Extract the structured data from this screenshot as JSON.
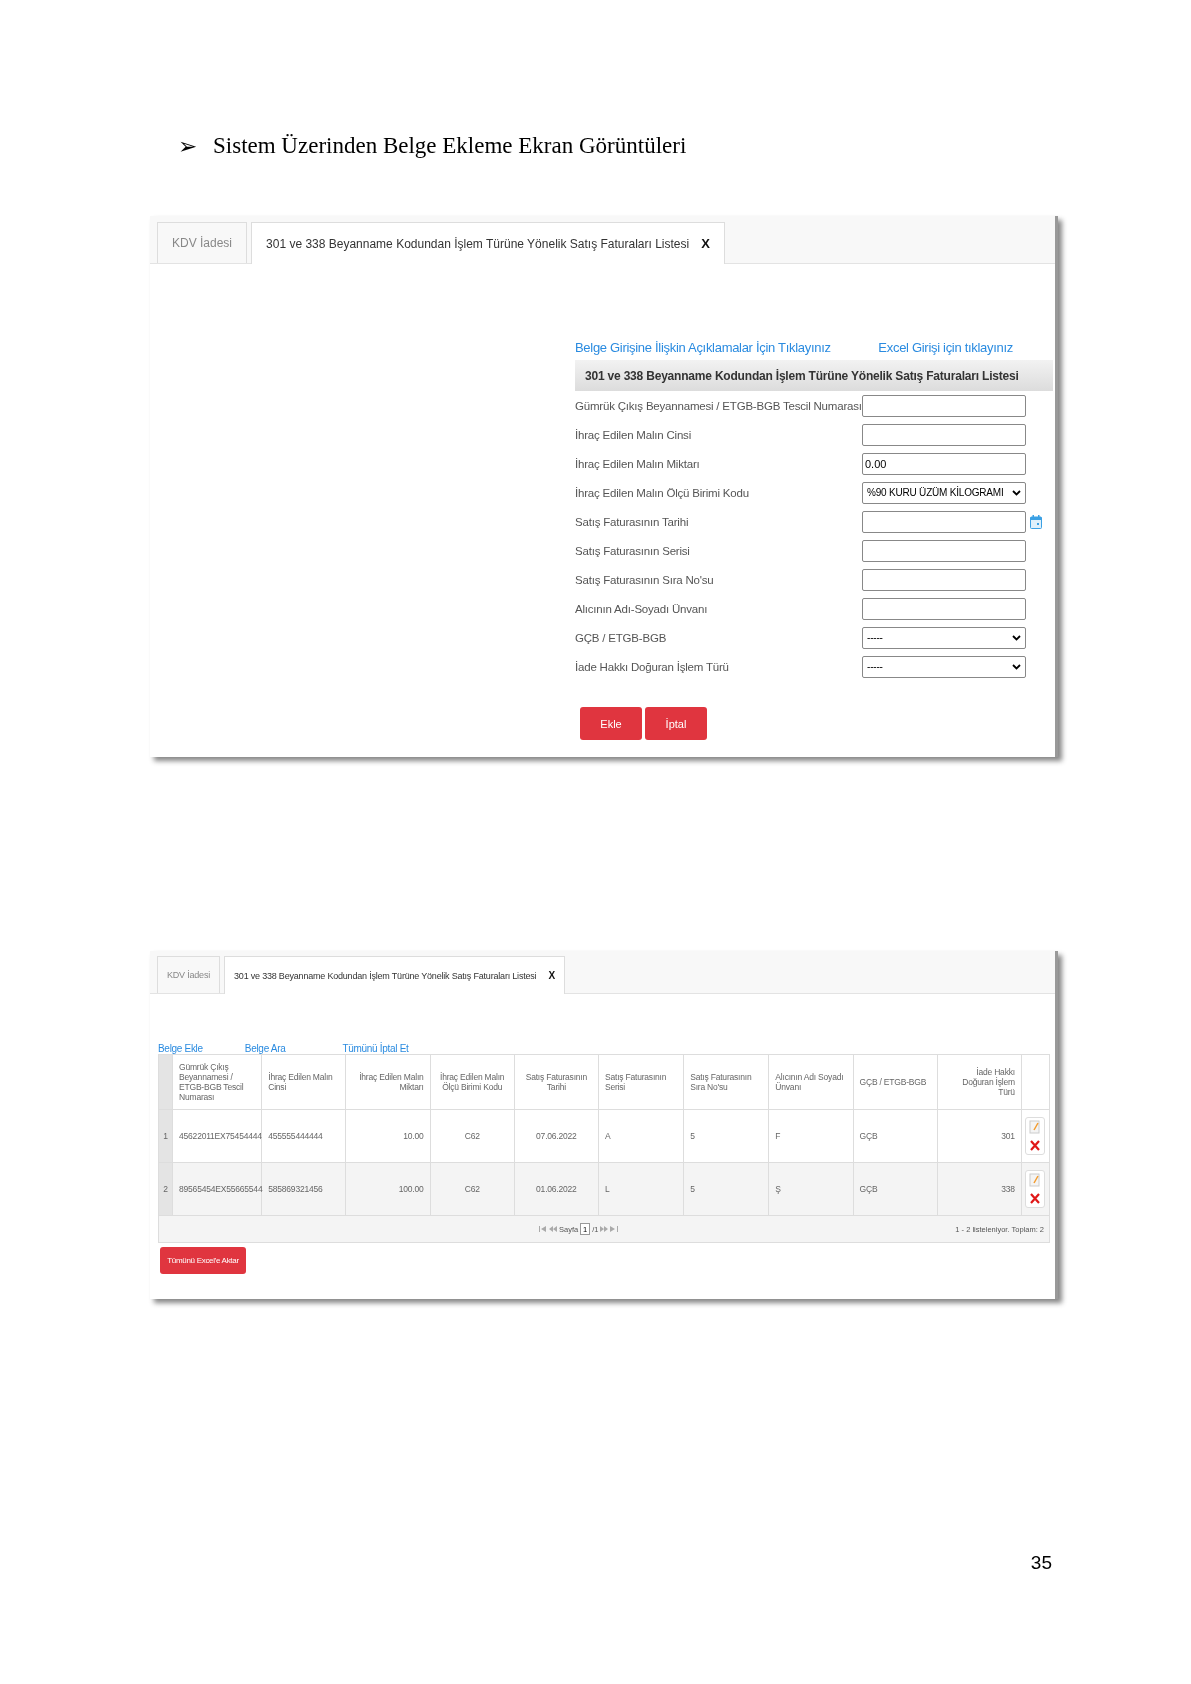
{
  "heading": {
    "bullet": "➢",
    "text": "Sistem Üzerinden Belge Ekleme Ekran Görüntüleri"
  },
  "form_screen": {
    "tabs": [
      {
        "label": "KDV İadesi",
        "selected": false
      },
      {
        "label": "301 ve 338 Beyanname Kodundan İşlem Türüne Yönelik Satış Faturaları Listesi",
        "selected": true,
        "close": "X"
      }
    ],
    "links": [
      "Belge Girişine İlişkin Açıklamalar İçin Tıklayınız",
      "Excel Girişi için tıklayınız"
    ],
    "panel_title": "301 ve 338 Beyanname Kodundan İşlem Türüne Yönelik Satış Faturaları Listesi",
    "fields": [
      {
        "label": "Gümrük Çıkış Beyannamesi / ETGB-BGB Tescil Numarası",
        "kind": "text"
      },
      {
        "label": "İhraç Edilen Malın Cinsi",
        "kind": "text"
      },
      {
        "label": "İhraç Edilen Malın Miktarı",
        "kind": "text",
        "value": "0.00"
      },
      {
        "label": "İhraç Edilen Malın Ölçü Birimi Kodu",
        "kind": "select",
        "value": "%90 KURU ÜZÜM KİLOGRAMI"
      },
      {
        "label": "Satış Faturasının Tarihi",
        "kind": "date"
      },
      {
        "label": "Satış Faturasının Serisi",
        "kind": "text"
      },
      {
        "label": "Satış Faturasının Sıra No'su",
        "kind": "text"
      },
      {
        "label": "Alıcının Adı-Soyadı Ünvanı",
        "kind": "text"
      },
      {
        "label": "GÇB / ETGB-BGB",
        "kind": "select",
        "value": "-----"
      },
      {
        "label": "İade Hakkı Doğuran İşlem Türü",
        "kind": "select",
        "value": "-----"
      }
    ],
    "buttons": [
      "Ekle",
      "İptal"
    ]
  },
  "list_screen": {
    "tabs": [
      {
        "label": "KDV İadesi",
        "selected": false
      },
      {
        "label": "301 ve 338 Beyanname Kodundan İşlem Türüne Yönelik Satış Faturaları Listesi",
        "selected": true,
        "close": "X"
      }
    ],
    "actions": [
      "Belge Ekle",
      "Belge Ara",
      "Tümünü İptal Et"
    ],
    "columns": [
      "Gümrük Çıkış Beyannamesi / ETGB-BGB Tescil Numarası",
      "İhraç Edilen Malın Cinsi",
      "İhraç Edilen Malın Miktarı",
      "İhraç Edilen Malın Ölçü Birimi Kodu",
      "Satış Faturasının Tarihi",
      "Satış Faturasının Serisi",
      "Satış Faturasının Sıra No'su",
      "Alıcının Adı Soyadı Ünvanı",
      "GÇB / ETGB-BGB",
      "İade Hakkı Doğuran İşlem Türü"
    ],
    "rows": [
      {
        "index": "1",
        "cells": [
          "45622011EX75454444",
          "455555444444",
          "10.00",
          "C62",
          "07.06.2022",
          "A",
          "5",
          "F",
          "GÇB",
          "301"
        ]
      },
      {
        "index": "2",
        "cells": [
          "89565454EX55665544",
          "585869321456",
          "100.00",
          "C62",
          "01.06.2022",
          "L",
          "5",
          "Ş",
          "GÇB",
          "338"
        ]
      }
    ],
    "pager": {
      "label": "Sayfa",
      "page": "1",
      "total": "/1"
    },
    "summary": "1 - 2 listeleniyor. Toplam: 2",
    "export_button": "Tümünü Excel'e Aktar"
  },
  "page_number": "35"
}
